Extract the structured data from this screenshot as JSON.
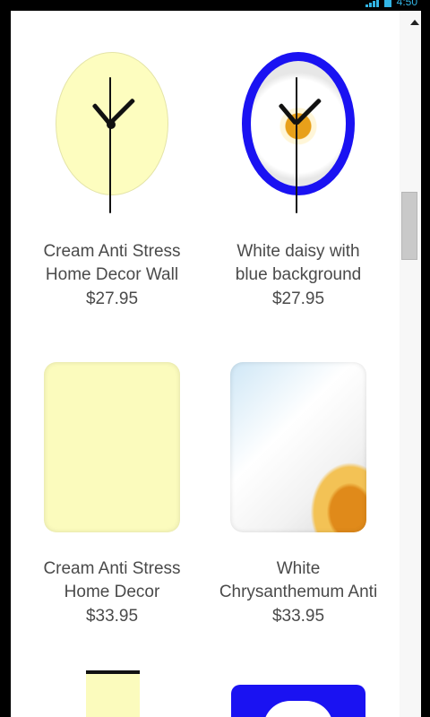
{
  "status_bar": {
    "time": "4:50"
  },
  "products": [
    {
      "title_line1": "Cream Anti Stress",
      "title_line2": "Home Decor Wall",
      "price": "$27.95",
      "icon": "cream-wall-clock-image"
    },
    {
      "title_line1": "White daisy with",
      "title_line2": "blue background",
      "price": "$27.95",
      "icon": "daisy-wall-clock-image"
    },
    {
      "title_line1": "Cream Anti Stress",
      "title_line2": "Home Decor",
      "price": "$33.95",
      "icon": "cream-pillow-image"
    },
    {
      "title_line1": "White",
      "title_line2": "Chrysanthemum Anti",
      "price": "$33.95",
      "icon": "chrysanthemum-pillow-image"
    }
  ],
  "colors": {
    "cream": "#fdfdbf",
    "blue": "#1a12f2",
    "scroll_thumb": "#c9c9c9"
  }
}
